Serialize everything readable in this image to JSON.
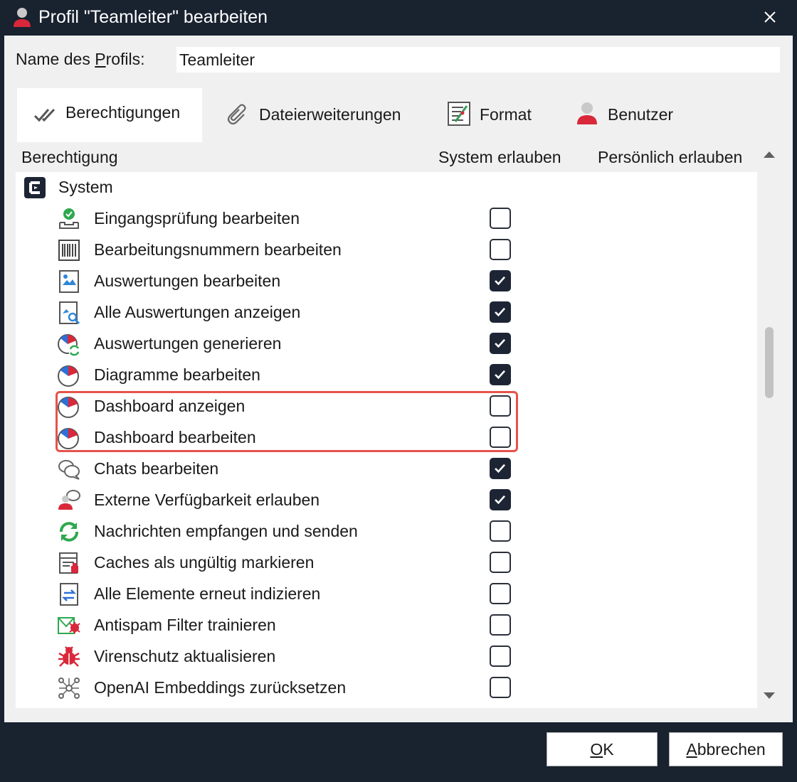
{
  "window": {
    "title": "Profil \"Teamleiter\" bearbeiten",
    "title_icon": "user-profile-icon",
    "close_icon": "close-icon"
  },
  "profile": {
    "name_label_prefix": "Name des ",
    "name_label_mnemonic": "P",
    "name_label_suffix": "rofils:",
    "name_value": "Teamleiter"
  },
  "tabs": [
    {
      "label": "Berechtigungen",
      "icon": "checkmarks-icon",
      "active": true
    },
    {
      "label": "Dateierweiterungen",
      "icon": "paperclip-icon",
      "active": false
    },
    {
      "label": "Format",
      "icon": "format-icon",
      "active": false
    },
    {
      "label": "Benutzer",
      "icon": "user-icon",
      "active": false
    }
  ],
  "columns": {
    "permission": "Berechtigung",
    "system_allow": "System erlauben",
    "personal_allow": "Persönlich erlauben"
  },
  "group": {
    "label": "System",
    "icon": "system-app-icon"
  },
  "permissions": [
    {
      "label": "Eingangsprüfung bearbeiten",
      "icon": "inbox-check-icon",
      "system": false
    },
    {
      "label": "Bearbeitungsnummern bearbeiten",
      "icon": "barcode-icon",
      "system": false
    },
    {
      "label": "Auswertungen bearbeiten",
      "icon": "report-image-icon",
      "system": true
    },
    {
      "label": "Alle Auswertungen anzeigen",
      "icon": "report-search-icon",
      "system": true
    },
    {
      "label": "Auswertungen generieren",
      "icon": "pie-refresh-icon",
      "system": true
    },
    {
      "label": "Diagramme bearbeiten",
      "icon": "pie-chart-icon",
      "system": true
    },
    {
      "label": "Dashboard anzeigen",
      "icon": "pie-chart-icon",
      "system": false
    },
    {
      "label": "Dashboard bearbeiten",
      "icon": "pie-chart-icon",
      "system": false
    },
    {
      "label": "Chats bearbeiten",
      "icon": "chat-bubbles-icon",
      "system": true
    },
    {
      "label": "Externe Verfügbarkeit erlauben",
      "icon": "external-users-icon",
      "system": true
    },
    {
      "label": "Nachrichten empfangen und senden",
      "icon": "sync-arrows-icon",
      "system": false
    },
    {
      "label": "Caches als ungültig markieren",
      "icon": "cache-invalidate-icon",
      "system": false
    },
    {
      "label": "Alle Elemente erneut indizieren",
      "icon": "reindex-icon",
      "system": false
    },
    {
      "label": "Antispam Filter trainieren",
      "icon": "antispam-icon",
      "system": false
    },
    {
      "label": "Virenschutz aktualisieren",
      "icon": "virus-icon",
      "system": false
    },
    {
      "label": "OpenAI Embeddings zurücksetzen",
      "icon": "network-nodes-icon",
      "system": false
    }
  ],
  "buttons": {
    "ok_mnemonic": "O",
    "ok_rest": "K",
    "cancel_mnemonic": "A",
    "cancel_rest": "bbrechen"
  },
  "colors": {
    "window_bg": "#19222f",
    "highlight": "#e5534b",
    "checked": "#1d2535"
  }
}
